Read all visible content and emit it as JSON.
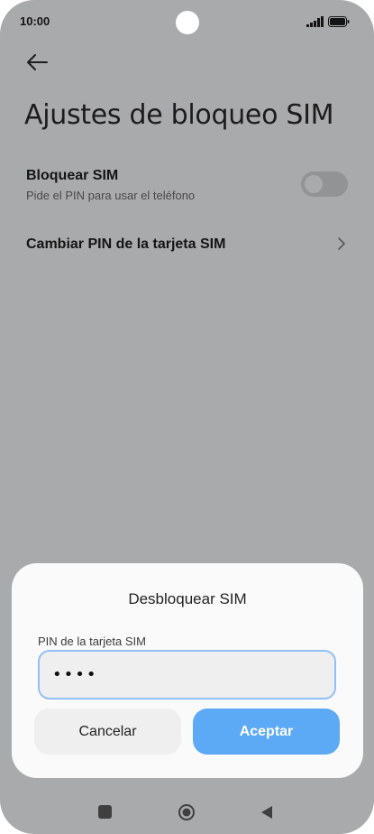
{
  "status_bar": {
    "time": "10:00"
  },
  "page": {
    "title": "Ajustes de bloqueo SIM",
    "rows": [
      {
        "title": "Bloquear SIM",
        "subtitle": "Pide el PIN para usar el teléfono",
        "toggle_on": false
      },
      {
        "title": "Cambiar PIN de la tarjeta SIM"
      }
    ]
  },
  "dialog": {
    "title": "Desbloquear SIM",
    "field_label": "PIN de la tarjeta SIM",
    "field_value": "••••",
    "cancel_label": "Cancelar",
    "accept_label": "Aceptar"
  },
  "colors": {
    "accent": "#5ca9f5",
    "input_border": "#93bff6",
    "scrim": "#a9aaab"
  },
  "icons": {
    "back": "back-arrow-icon",
    "chevron": "chevron-right-icon",
    "nav_recents": "square-icon",
    "nav_home": "circle-home-icon",
    "nav_back": "triangle-back-icon"
  }
}
